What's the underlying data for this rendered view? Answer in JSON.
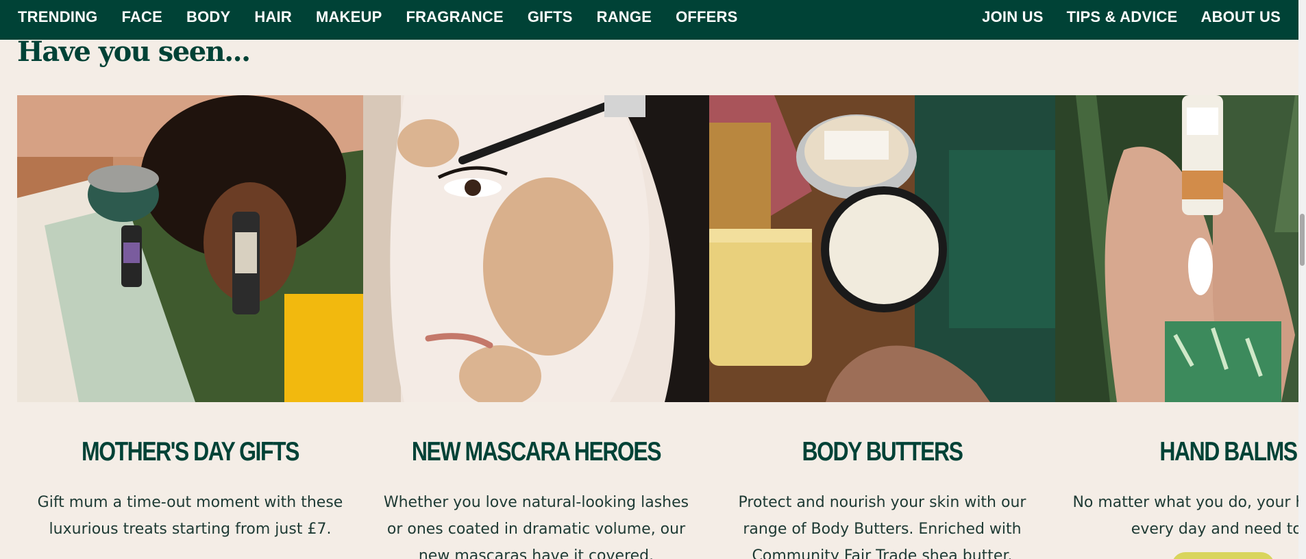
{
  "nav": {
    "left": [
      "TRENDING",
      "FACE",
      "BODY",
      "HAIR",
      "MAKEUP",
      "FRAGRANCE",
      "GIFTS",
      "RANGE",
      "OFFERS"
    ],
    "right": [
      "JOIN US",
      "TIPS & ADVICE",
      "ABOUT US"
    ]
  },
  "section": {
    "title": "Have you seen..."
  },
  "cards": [
    {
      "title": "MOTHER'S DAY GIFTS",
      "description": "Gift mum a time-out moment with these luxurious treats starting from just £7."
    },
    {
      "title": "NEW MASCARA HEROES",
      "description": "Whether you love natural-looking lashes or ones coated in dramatic volume, our new mascaras have it covered."
    },
    {
      "title": "BODY BUTTERS",
      "description": "Protect and nourish your skin with our range of Body Butters. Enriched with Community Fair Trade shea butter."
    },
    {
      "title": "HAND BALMS",
      "description": "No matter what you do, your hands work hard every day and need to be soft."
    }
  ],
  "colors": {
    "brand_green": "#004236",
    "page_background": "#f4ede6",
    "chat_button": "#d9d55c"
  }
}
